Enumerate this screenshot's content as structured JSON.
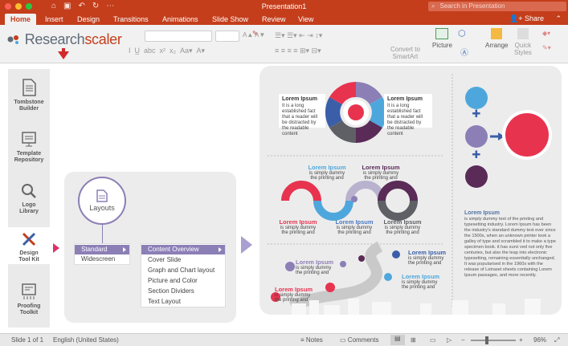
{
  "titlebar": {
    "title": "Presentation1",
    "search_placeholder": "Search in Presentation"
  },
  "tabs": [
    "Home",
    "Insert",
    "Design",
    "Transitions",
    "Animations",
    "Slide Show",
    "Review",
    "View"
  ],
  "share_label": "Share",
  "ribbon": {
    "convert_line1": "Convert to",
    "convert_line2": "SmartArt",
    "picture": "Picture",
    "arrange": "Arrange",
    "quick1": "Quick",
    "quick2": "Styles"
  },
  "logo": {
    "part1": "Research",
    "part2": "scaler"
  },
  "sidebar": [
    {
      "line1": "Tombstone",
      "line2": "Builder",
      "icon": "document-icon"
    },
    {
      "line1": "Template",
      "line2": "Repository",
      "icon": "template-icon"
    },
    {
      "line1": "Logo",
      "line2": "Library",
      "icon": "magnifier-icon"
    },
    {
      "line1": "Design",
      "line2": "Tool Kit",
      "icon": "tools-icon"
    },
    {
      "line1": "Proofing",
      "line2": "Toolkit",
      "icon": "proofing-icon"
    }
  ],
  "layouts": {
    "label": "Layouts"
  },
  "menu1": [
    "Standard",
    "Widescreen"
  ],
  "menu2": [
    "Content Overview",
    "Cover Slide",
    "Graph and Chart layout",
    "Picture and Color",
    "Section Dividers",
    "Text Layout"
  ],
  "slide": {
    "heading": "Lorem Ipsum",
    "body3": "It is a long established fact that a reader will be distracted by the readable content",
    "dummy": "is simply dummy the printing and",
    "para_title": "Lorem Ipsum",
    "para_text": "is simply dummy text of the printing and typesetting industry. Lorem Ipsum has been the industry's standard dummy text ever since the 1500s, when an unknown printer took a galley of type and scrambled it to make a type specimen book. it has survi ved not only five centuries, but also the leap into electronic typesetting, remaining essentially unchanged. It was popularised in the 1960s with the release of Letraset sheets containing Lorem Ipsum passages, and more recently."
  },
  "status": {
    "slide": "Slide 1 of 1",
    "lang": "English (United States)",
    "notes": "Notes",
    "comments": "Comments",
    "zoom": "96%"
  },
  "colors": {
    "accent": "#c43e1c",
    "purple": "#8c7fb6",
    "red": "#e8334f",
    "blue": "#4ea7dc",
    "gray": "#5f6065",
    "dark": "#5a2b57"
  }
}
